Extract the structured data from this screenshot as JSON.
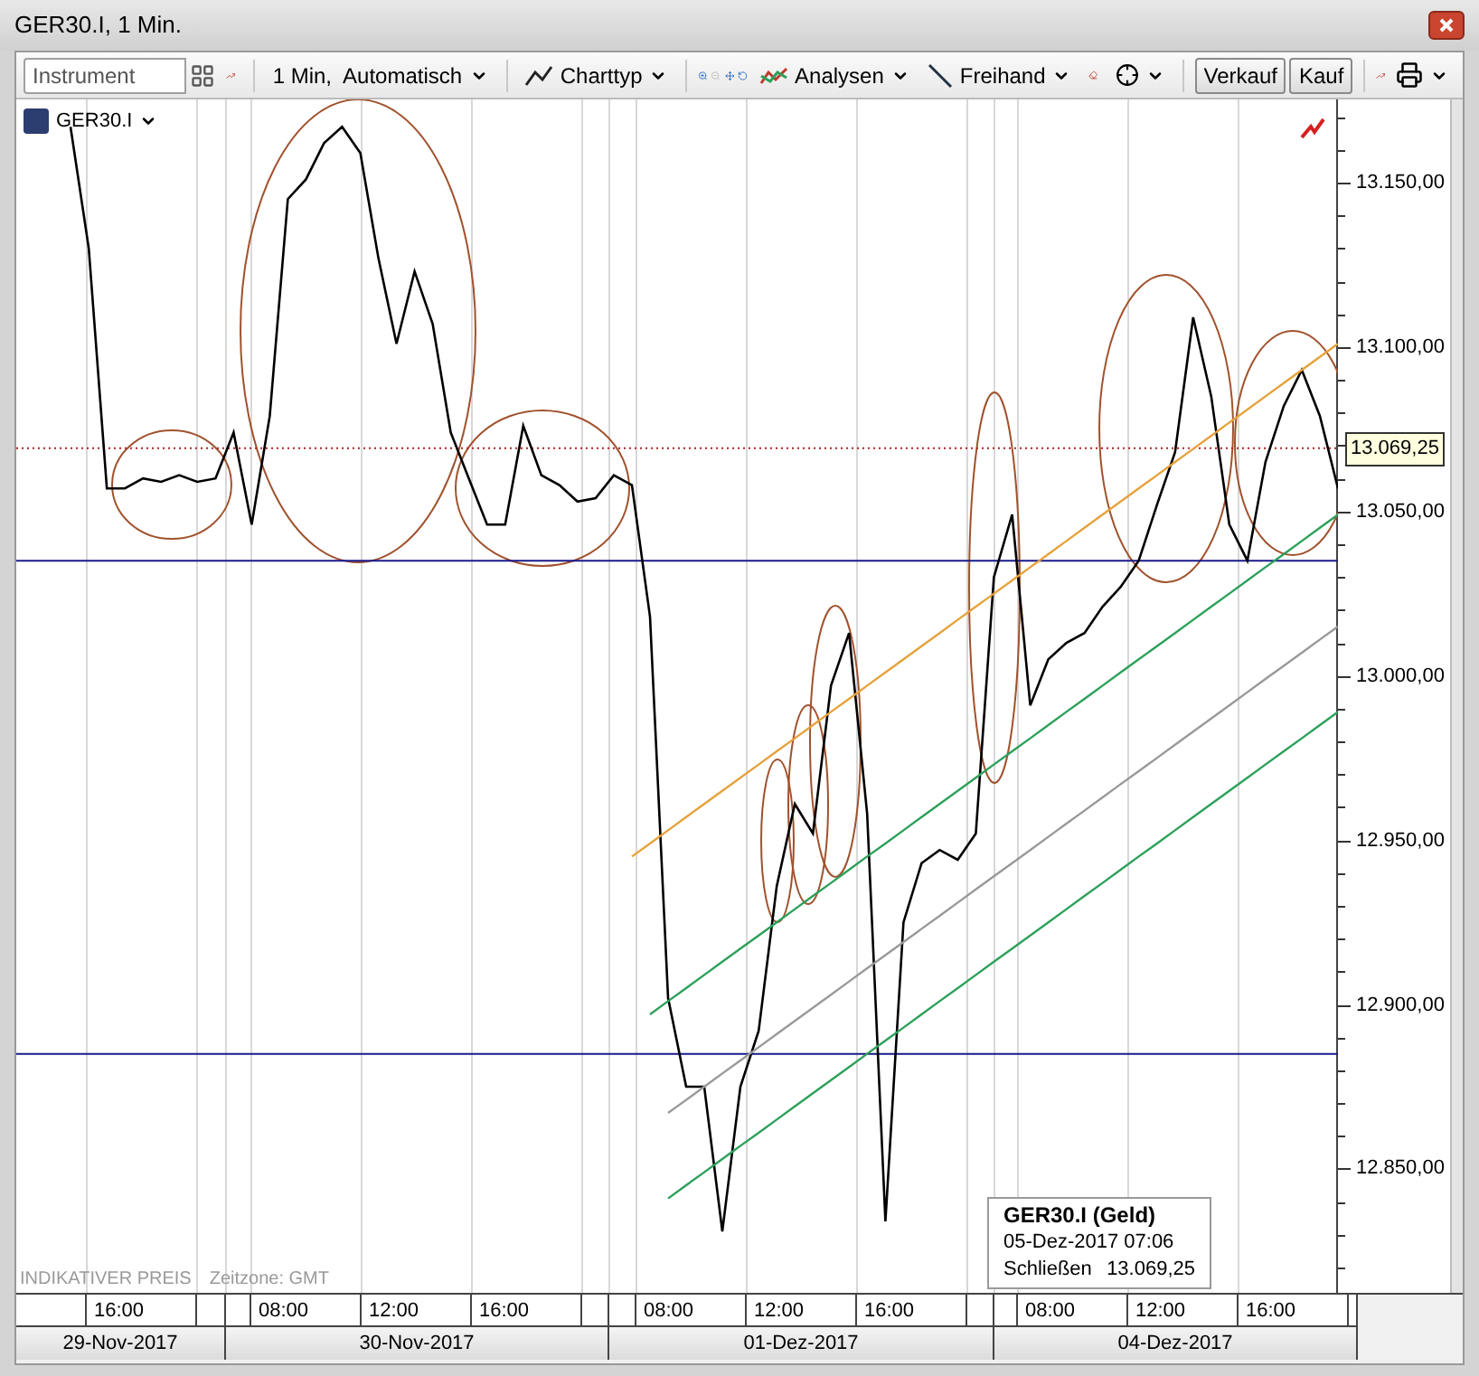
{
  "window": {
    "title": "GER30.I, 1 Min."
  },
  "toolbar": {
    "instrument": {
      "placeholder": "Instrument"
    },
    "interval": "1 Min,  Automatisch",
    "chart_type": "Charttyp",
    "zoom_out": {
      "disabled": true
    },
    "analyses": "Analysen",
    "freehand": "Freihand",
    "buttons": [
      "Verkauf",
      "Kauf"
    ]
  },
  "chart": {
    "current_price": "13.069,25",
    "chart_data": {
      "type": "line",
      "grid": true,
      "ylim": [
        12812.3,
        13175.3
      ],
      "ref_lines": [
        {
          "axis": "y",
          "value": 13069.25,
          "color": "#b22222"
        },
        {
          "axis": "y",
          "value": 13035,
          "color": "#1a1a8c"
        },
        {
          "axis": "y",
          "value": 12885,
          "color": "#1a1a8c"
        }
      ],
      "yticks": [
        {
          "value": 13150,
          "label": "13.150,00"
        },
        {
          "value": 13100,
          "label": "13.100,00"
        },
        {
          "value": 13050,
          "label": "13.050,00"
        },
        {
          "value": 13000,
          "label": "13.000,00"
        },
        {
          "value": 12950,
          "label": "12.950,00"
        },
        {
          "value": 12900,
          "label": "12.900,00"
        },
        {
          "value": 12850,
          "label": "12.850,00"
        }
      ],
      "series": [
        {
          "name": "GER30.I",
          "color": "#000000",
          "values": [
            null,
            null,
            null,
            13167,
            13130,
            13057,
            13057,
            13060,
            13059,
            13061,
            13059,
            13060,
            13074,
            13046,
            13079,
            13145,
            13151,
            13162,
            13167,
            13159,
            13127,
            13101,
            13123,
            13107,
            13074,
            13060,
            13046,
            13046,
            13076,
            13061,
            13058,
            13053,
            13054,
            13061,
            13058,
            13018,
            12902,
            12875,
            12875,
            12831,
            12875,
            12892,
            12936,
            12961,
            12952,
            12997,
            13013,
            12958,
            12834,
            12925,
            12943,
            12947,
            12944,
            12952,
            13030,
            13049,
            12991,
            13005,
            13010,
            13013,
            13021,
            13027,
            13035,
            13052,
            13068,
            13109,
            13085,
            13046,
            13035,
            13065,
            13082,
            13093,
            13079,
            13057
          ]
        },
        {
          "color": "#e6a23c",
          "values": [
            null,
            null,
            null,
            null,
            null,
            null,
            null,
            null,
            null,
            null,
            null,
            null,
            null,
            null,
            null,
            null,
            null,
            null,
            null,
            null,
            null,
            null,
            null,
            null,
            null,
            null,
            null,
            null,
            null,
            null,
            null,
            null,
            null,
            null,
            12945,
            12949,
            12953,
            12957,
            12961,
            12965,
            12969,
            12973,
            12977,
            12981,
            12985,
            12989,
            12993,
            12997,
            13001,
            13005,
            13009,
            13013,
            13017,
            13021,
            13025,
            13029,
            13033,
            13037,
            13041,
            13045,
            13049,
            13053,
            13057,
            13061,
            13065,
            13069,
            13073,
            13077,
            13081,
            13085,
            13089,
            13093,
            13097,
            13101
          ]
        },
        {
          "color": "#2ca05a",
          "values": [
            null,
            null,
            null,
            null,
            null,
            null,
            null,
            null,
            null,
            null,
            null,
            null,
            null,
            null,
            null,
            null,
            null,
            null,
            null,
            null,
            null,
            null,
            null,
            null,
            null,
            null,
            null,
            null,
            null,
            null,
            null,
            null,
            null,
            null,
            null,
            12897,
            12901,
            12905,
            12909,
            12913,
            12917,
            12921,
            12925,
            12929,
            12933,
            12937,
            12941,
            12945,
            12949,
            12953,
            12957,
            12961,
            12965,
            12969,
            12973,
            12977,
            12981,
            12985,
            12989,
            12993,
            12997,
            13001,
            13005,
            13009,
            13013,
            13017,
            13021,
            13025,
            13029,
            13033,
            13037,
            13041,
            13045,
            13049
          ]
        },
        {
          "color": "#999999",
          "values": [
            null,
            null,
            null,
            null,
            null,
            null,
            null,
            null,
            null,
            null,
            null,
            null,
            null,
            null,
            null,
            null,
            null,
            null,
            null,
            null,
            null,
            null,
            null,
            null,
            null,
            null,
            null,
            null,
            null,
            null,
            null,
            null,
            null,
            null,
            null,
            null,
            12867,
            12871,
            12875,
            12879,
            12883,
            12887,
            12891,
            12895,
            12899,
            12903,
            12907,
            12911,
            12915,
            12919,
            12923,
            12927,
            12931,
            12935,
            12939,
            12943,
            12947,
            12951,
            12955,
            12959,
            12963,
            12967,
            12971,
            12975,
            12979,
            12983,
            12987,
            12991,
            12995,
            12999,
            13003,
            13007,
            13011,
            13015
          ]
        },
        {
          "color": "#2ca05a",
          "values": [
            null,
            null,
            null,
            null,
            null,
            null,
            null,
            null,
            null,
            null,
            null,
            null,
            null,
            null,
            null,
            null,
            null,
            null,
            null,
            null,
            null,
            null,
            null,
            null,
            null,
            null,
            null,
            null,
            null,
            null,
            null,
            null,
            null,
            null,
            null,
            null,
            12841,
            12845,
            12849,
            12853,
            12857,
            12861,
            12865,
            12869,
            12873,
            12877,
            12881,
            12885,
            12889,
            12893,
            12897,
            12901,
            12905,
            12909,
            12913,
            12917,
            12921,
            12925,
            12929,
            12933,
            12937,
            12941,
            12945,
            12949,
            12953,
            12957,
            12961,
            12965,
            12969,
            12973,
            12977,
            12981,
            12985,
            12989
          ]
        }
      ]
    },
    "indicative_note": "INDIKATIVER PREIS",
    "timezone": "Zeitzone: GMT",
    "info_box": {
      "title": "GER30.I (Geld)",
      "datetime": "05-Dez-2017 07:06",
      "label": "Schließen",
      "value": "13.069,25"
    }
  },
  "time_axis": {
    "days": [
      {
        "date": "29-Nov-2017",
        "hours": [
          "16:00"
        ]
      },
      {
        "date": "30-Nov-2017",
        "hours": [
          "08:00",
          "12:00",
          "16:00"
        ]
      },
      {
        "date": "01-Dez-2017",
        "hours": [
          "08:00",
          "12:00",
          "16:00"
        ]
      },
      {
        "date": "04-Dez-2017",
        "hours": [
          "08:00",
          "12:00",
          "16:00"
        ]
      }
    ]
  }
}
